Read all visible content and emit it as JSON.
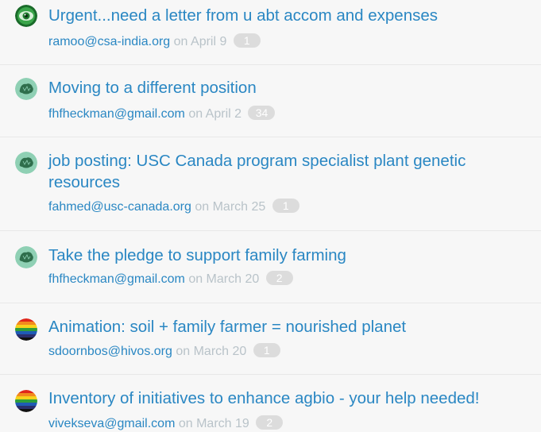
{
  "threads": [
    {
      "title": "Urgent...need a letter from u abt accom and expenses",
      "author": "ramoo@csa-india.org",
      "date": "on April 9",
      "count": "1",
      "avatar": "eye-avatar"
    },
    {
      "title": "Moving to a different position",
      "author": "fhfheckman@gmail.com",
      "date": "on April 2",
      "count": "34",
      "avatar": "leaf-avatar"
    },
    {
      "title": "job posting: USC Canada program specialist plant genetic resources",
      "author": "fahmed@usc-canada.org",
      "date": "on March 25",
      "count": "1",
      "avatar": "leaf-avatar"
    },
    {
      "title": "Take the pledge to support family farming",
      "author": "fhfheckman@gmail.com",
      "date": "on March 20",
      "count": "2",
      "avatar": "leaf-avatar"
    },
    {
      "title": "Animation: soil + family farmer = nourished planet",
      "author": "sdoornbos@hivos.org",
      "date": "on March 20",
      "count": "1",
      "avatar": "rainbow-avatar"
    },
    {
      "title": "Inventory of initiatives to enhance agbio - your help needed!",
      "author": "vivekseva@gmail.com",
      "date": "on March 19",
      "count": "2",
      "avatar": "rainbow-avatar"
    }
  ]
}
